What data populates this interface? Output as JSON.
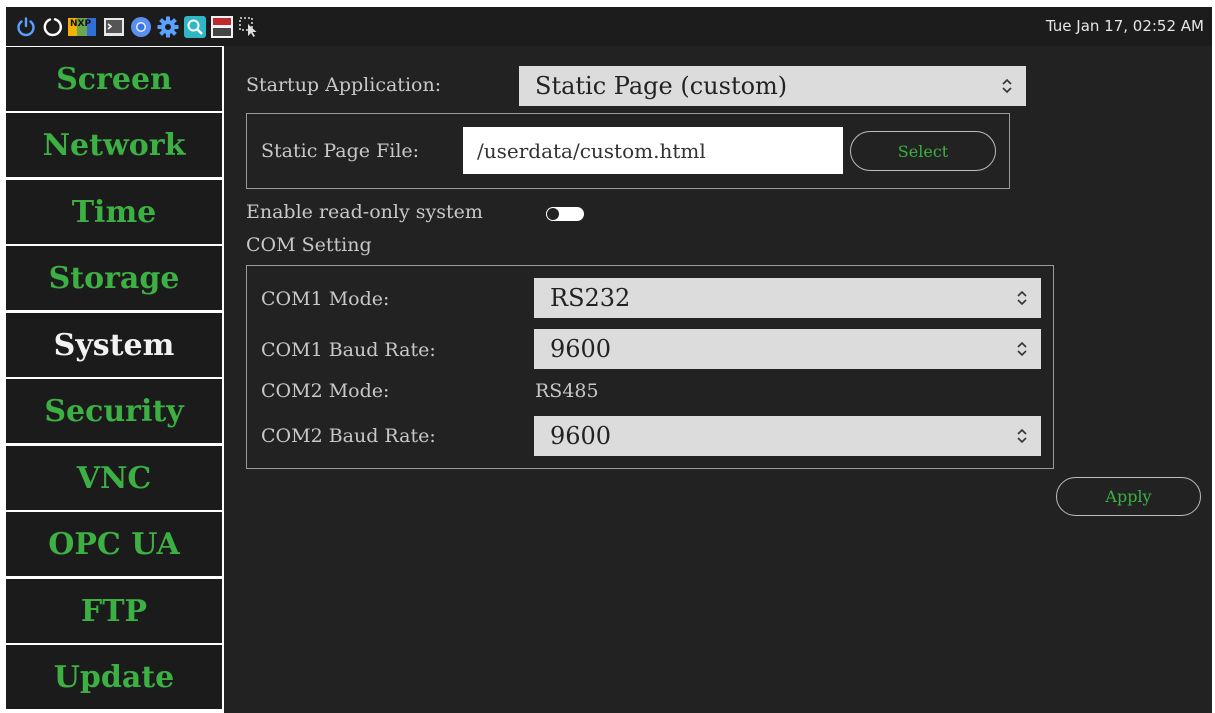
{
  "taskbar": {
    "icons": [
      "power-icon",
      "restart-icon",
      "nxp-app-icon",
      "terminal-icon",
      "chromium-icon",
      "settings-gear-icon",
      "search-app-icon",
      "tightvnc-icon",
      "screen-select-icon"
    ],
    "nxp_text": "NXP",
    "clock": "Tue Jan 17, 02:52 AM"
  },
  "sidebar": {
    "items": [
      {
        "label": "Screen"
      },
      {
        "label": "Network"
      },
      {
        "label": "Time"
      },
      {
        "label": "Storage"
      },
      {
        "label": "System",
        "active": true
      },
      {
        "label": "Security"
      },
      {
        "label": "VNC"
      },
      {
        "label": "OPC UA"
      },
      {
        "label": "FTP"
      },
      {
        "label": "Update"
      }
    ]
  },
  "colors": {
    "accent_green": "#3cb043",
    "background": "#222222",
    "sidebar_bg": "#1b1b1b"
  },
  "system": {
    "startup_label": "Startup Application:",
    "startup_value": "Static Page (custom)",
    "static_file_label": "Static Page File:",
    "static_file_value": "/userdata/custom.html",
    "select_button": "Select",
    "readonly_label": "Enable read-only system",
    "readonly_enabled": false,
    "com_setting_label": "COM Setting",
    "com1_mode_label": "COM1 Mode:",
    "com1_mode_value": "RS232",
    "com1_baud_label": "COM1 Baud Rate:",
    "com1_baud_value": "9600",
    "com2_mode_label": "COM2 Mode:",
    "com2_mode_value": "RS485",
    "com2_baud_label": "COM2 Baud Rate:",
    "com2_baud_value": "9600",
    "apply_button": "Apply"
  }
}
